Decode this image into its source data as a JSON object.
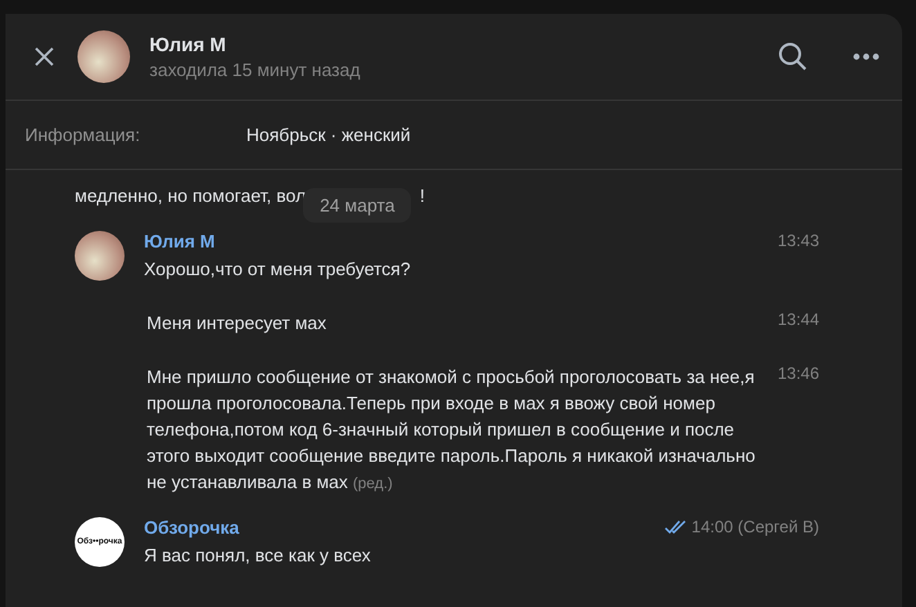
{
  "header": {
    "name": "Юлия М",
    "status": "заходила 15 минут назад"
  },
  "info": {
    "label": "Информация:",
    "value": "Ноябрьск · женский"
  },
  "partial_message": {
    "before": "медленно, но помогает, вол",
    "after": "!"
  },
  "date_pill": "24 марта",
  "messages": [
    {
      "kind": "first",
      "author": "Юлия М",
      "text": "Хорошо,что от меня требуется?",
      "time": "13:43"
    },
    {
      "kind": "continued",
      "text": "Меня интересует мах",
      "time": "13:44"
    },
    {
      "kind": "continued",
      "text": "Мне пришло сообщение от знакомой с просьбой проголосовать за нее,я прошла проголосовала.Теперь при входе в мах я ввожу свой номер телефона,потом код 6-значный который пришел в сообщение и после этого выходит сообщение введите пароль.Пароль я никакой изначально не устанавливала в мах",
      "edited": "(ред.)",
      "time": "13:46"
    },
    {
      "kind": "first",
      "author": "Обзорочка",
      "logo_text": "Обз••рочка",
      "text": "Я вас понял, все как у всех",
      "time": "14:00 (Сергей В)",
      "read": true
    }
  ]
}
